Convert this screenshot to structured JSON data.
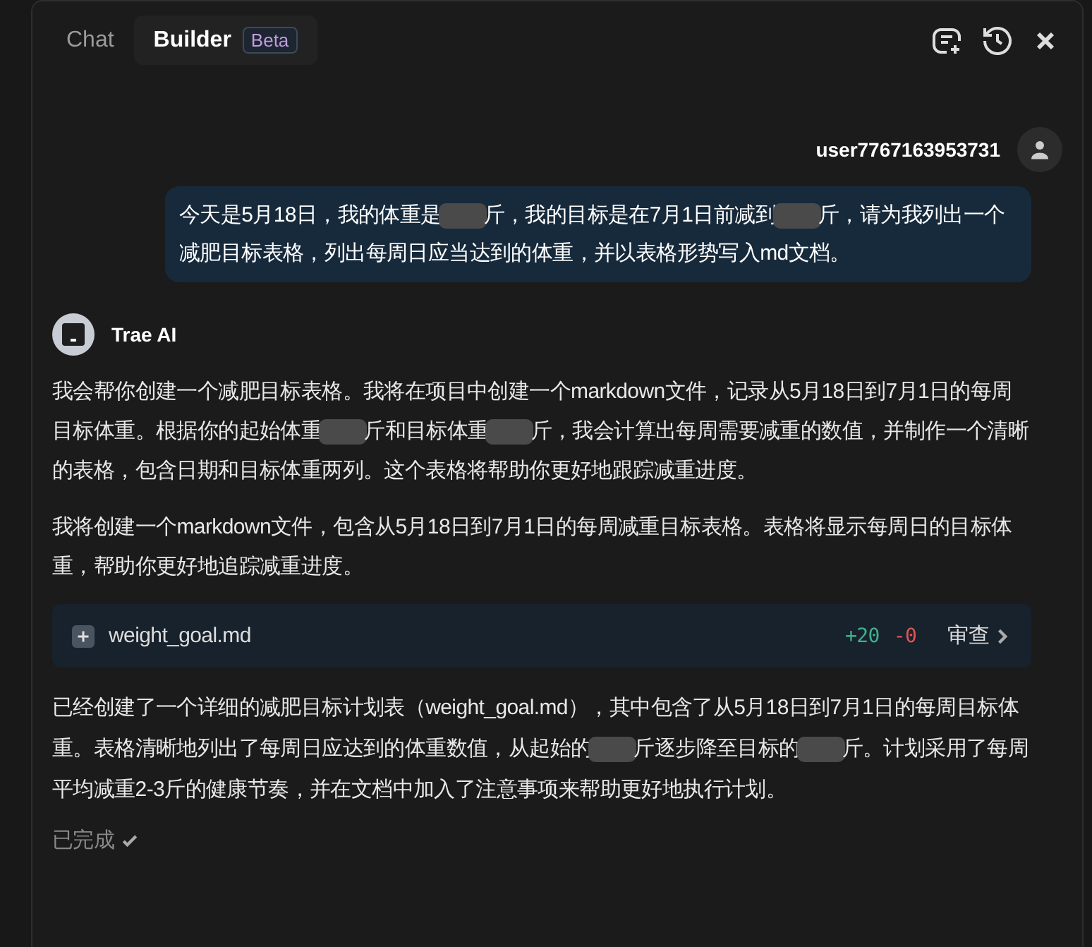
{
  "tabs": [
    {
      "label": "Chat",
      "selected": false
    },
    {
      "label": "Builder",
      "selected": true,
      "badge": "Beta"
    }
  ],
  "user": {
    "name": "user7767163953731",
    "segments": [
      "今天是5月18日，我的体重是",
      "斤，我的目标是在7月1日前减到",
      "斤，请为我列出一个减肥目标表格，列出每周日应当达到的体重，并以表格形势写入md文档。"
    ]
  },
  "assistant": {
    "name": "Trae AI",
    "paragraphs": [
      {
        "segments": [
          "我会帮你创建一个减肥目标表格。我将在项目中创建一个markdown文件，记录从5月18日到7月1日的每周目标体重。根据你的起始体重",
          "斤和目标体重",
          "斤，我会计算出每周需要减重的数值，并制作一个清晰的表格，包含日期和目标体重两列。这个表格将帮助你更好地跟踪减重进度。"
        ]
      },
      {
        "segments": [
          "我将创建一个markdown文件，包含从5月18日到7月1日的每周减重目标表格。表格将显示每周日的目标体重，帮助你更好地追踪减重进度。"
        ]
      }
    ],
    "file": {
      "name": "weight_goal.md",
      "added": "+20",
      "removed": "-0",
      "action": "审查"
    },
    "summary": {
      "segments": [
        "已经创建了一个详细的减肥目标计划表（weight_goal.md），其中包含了从5月18日到7月1日的每周目标体重。表格清晰地列出了每周日应达到的体重数值，从起始的",
        "斤逐步降至目标的",
        "斤。计划采用了每周平均减重2-3斤的健康节奏，并在文档中加入了注意事项来帮助更好地执行计划。"
      ]
    },
    "status": "已完成"
  }
}
